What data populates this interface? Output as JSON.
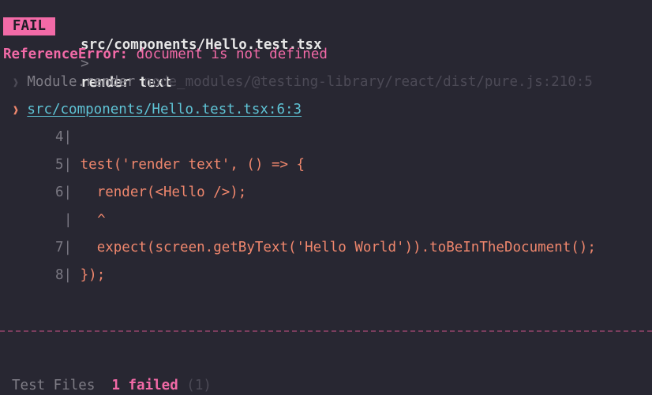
{
  "header": {
    "badge": "FAIL",
    "file": "src/components/Hello.test.tsx",
    "separator": ">",
    "test_name": "render text"
  },
  "error": {
    "type": "ReferenceError:",
    "message": "document is not defined"
  },
  "stack": [
    {
      "arrow": "❱",
      "fn": "Module.render",
      "location": "node_modules/@testing-library/react/dist/pure.js:210:5"
    },
    {
      "arrow": "❱",
      "location": "src/components/Hello.test.tsx:6:3"
    }
  ],
  "code_frame": [
    {
      "num": "4|",
      "code": ""
    },
    {
      "num": "5|",
      "code": "test('render text', () => {"
    },
    {
      "num": "6|",
      "code": "  render(<Hello />);"
    },
    {
      "num": "|",
      "code": "  ^"
    },
    {
      "num": "7|",
      "code": "  expect(screen.getByText('Hello World')).toBeInTheDocument();"
    },
    {
      "num": "8|",
      "code": "});"
    }
  ],
  "summary": {
    "label": "Test Files",
    "failed": "1 failed",
    "total": "(1)"
  },
  "colors": {
    "background": "#282732",
    "fail_pink": "#f26aa7",
    "code_orange": "#f0876d",
    "link_cyan": "#5fc4d6"
  }
}
